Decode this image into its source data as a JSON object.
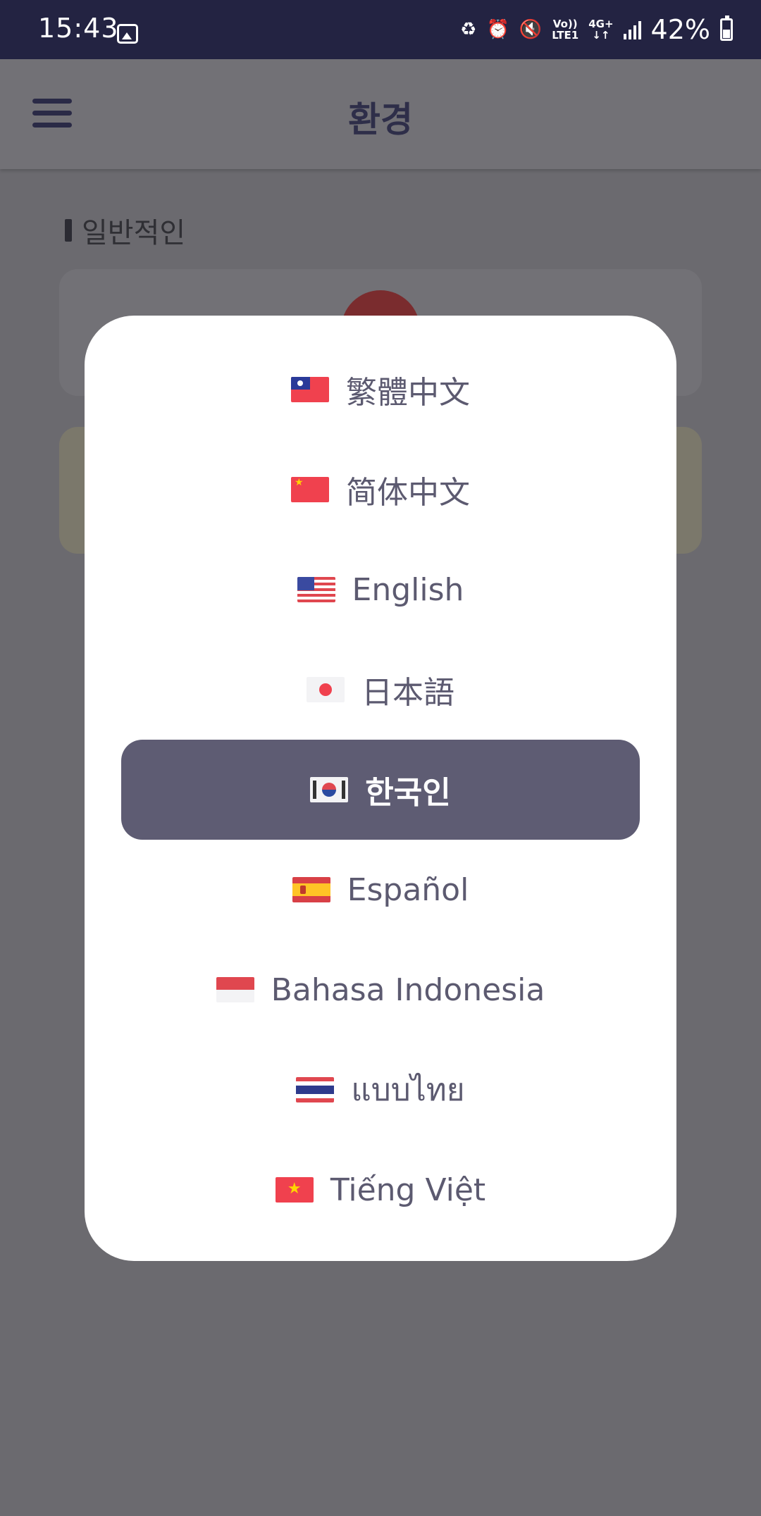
{
  "status_bar": {
    "time": "15:43",
    "network_top": "Vo))",
    "network_bottom": "LTE1",
    "network_type": "4G+",
    "battery_percent": "42%"
  },
  "header": {
    "title": "환경",
    "menu_icon": "hamburger-menu-icon"
  },
  "background": {
    "section_label": "일반적인"
  },
  "language_dialog": {
    "selected_index": 4,
    "options": [
      {
        "label": "繁體中文",
        "flag": "taiwan-flag-icon"
      },
      {
        "label": "简体中文",
        "flag": "china-flag-icon"
      },
      {
        "label": "English",
        "flag": "us-flag-icon"
      },
      {
        "label": "日本語",
        "flag": "japan-flag-icon"
      },
      {
        "label": "한국인",
        "flag": "korea-flag-icon"
      },
      {
        "label": "Español",
        "flag": "spain-flag-icon"
      },
      {
        "label": "Bahasa Indonesia",
        "flag": "indonesia-flag-icon"
      },
      {
        "label": "แบบไทย",
        "flag": "thailand-flag-icon"
      },
      {
        "label": "Tiếng Việt",
        "flag": "vietnam-flag-icon"
      }
    ]
  },
  "colors": {
    "status_bar": "#232342",
    "dialog_selected": "#5e5c73",
    "dialog_text": "#5c5a70",
    "overlay": "#6b6a6f"
  }
}
